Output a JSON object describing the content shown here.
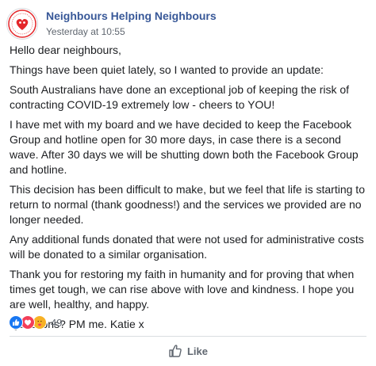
{
  "post": {
    "page_name": "Neighbours Helping Neighbours",
    "timestamp": "Yesterday at 10:55",
    "paragraphs": [
      "Hello dear neighbours,",
      "Things have been quiet lately, so I wanted to provide an update:",
      "South Australians have done an exceptional job of keeping the risk of contracting COVID-19 extremely low - cheers to YOU!",
      "I have met with my board and we have decided to keep the Facebook Group and hotline open for 30 more days, in case there is a second wave. After 30 days we will be shutting down both the Facebook Group and hotline.",
      "This decision has been difficult to make, but we feel that life is starting to return to normal (thank goodness!) and the services we provided are no longer needed.",
      "Any additional funds donated that were not used for administrative costs will be donated to a similar organisation.",
      "Thank you for restoring my faith in humanity and for proving that when times get tough, we can rise above with love and kindness. I hope you are well, healthy, and happy.",
      "Questions? PM me. Katie x"
    ]
  },
  "reactions": {
    "icons": [
      "like-icon",
      "love-icon",
      "care-icon"
    ],
    "count": "49"
  },
  "actions": {
    "like_label": "Like"
  },
  "colors": {
    "page_name": "#385898",
    "like_blue": "#1877f2",
    "love_red": "#f33e58",
    "care_yellow": "#f7b125",
    "muted": "#606770",
    "avatar_red": "#e4262a"
  }
}
